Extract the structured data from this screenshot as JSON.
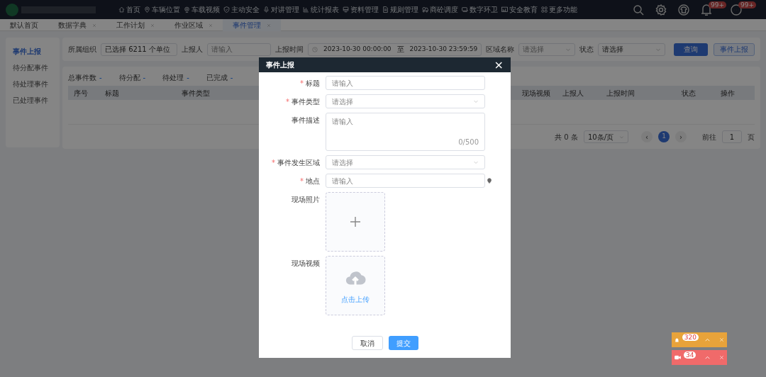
{
  "topnav": {
    "items": [
      {
        "label": "首页",
        "kind": "home"
      },
      {
        "label": "车辆位置",
        "kind": "pin"
      },
      {
        "label": "车载视频",
        "kind": "camera"
      },
      {
        "label": "主动安全",
        "kind": "shield"
      },
      {
        "label": "对讲管理",
        "kind": "mic"
      },
      {
        "label": "统计报表",
        "kind": "chart"
      },
      {
        "label": "资料管理",
        "kind": "monitor"
      },
      {
        "label": "规则管理",
        "kind": "doc"
      },
      {
        "label": "商砼调度",
        "kind": "truck"
      },
      {
        "label": "数字环卫",
        "kind": "screen"
      },
      {
        "label": "安全教育",
        "kind": "board"
      },
      {
        "label": "更多功能",
        "kind": "grid"
      }
    ],
    "tools": [
      {
        "kind": "search"
      },
      {
        "kind": "settings"
      },
      {
        "kind": "shirt"
      },
      {
        "kind": "bell",
        "badge": "99+"
      },
      {
        "kind": "more",
        "badge": "99+"
      }
    ]
  },
  "tabs": [
    {
      "label": "默认首页",
      "selected": false,
      "closable": false
    },
    {
      "label": "数据字典",
      "selected": false,
      "closable": true
    },
    {
      "label": "工作计划",
      "selected": false,
      "closable": true
    },
    {
      "label": "作业区域",
      "selected": false,
      "closable": true
    },
    {
      "label": "事件管理",
      "selected": true,
      "closable": true
    }
  ],
  "sidebar": {
    "items": [
      {
        "label": "事件上报",
        "selected": true
      },
      {
        "label": "待分配事件",
        "selected": false
      },
      {
        "label": "待处理事件",
        "selected": false
      },
      {
        "label": "已处理事件",
        "selected": false
      }
    ]
  },
  "filters": [
    {
      "label": "所属组织",
      "kind": "text",
      "value": "已选择 6211 个单位"
    },
    {
      "label": "上报人",
      "kind": "text",
      "placeholder": "请输入"
    },
    {
      "label": "上报时间",
      "kind": "daterange",
      "start": "2023-10-30 00:00:00",
      "separator": "至",
      "end": "2023-10-30 23:59:59"
    },
    {
      "label": "区域名称",
      "kind": "select",
      "placeholder": "请选择"
    },
    {
      "label": "状态",
      "kind": "select",
      "value": "请选择"
    }
  ],
  "actions": [
    {
      "label": "查询",
      "kind": "primary"
    },
    {
      "label": "事件上报",
      "kind": "plain"
    }
  ],
  "stats": [
    {
      "label": "总事件数",
      "value": "-"
    },
    {
      "label": "待分配",
      "value": "-"
    },
    {
      "label": "待处理",
      "value": "-"
    },
    {
      "label": "已完成",
      "value": "-"
    }
  ],
  "table": {
    "columns": [
      "序号",
      "标题",
      "事件类型",
      "现场视频",
      "上报人",
      "上报时间",
      "状态",
      "操作"
    ]
  },
  "pagination": {
    "total": "共 0 条",
    "page_size": "10条/页",
    "prev": "‹",
    "pages": [
      {
        "label": "1",
        "selected": true
      }
    ],
    "next": "›",
    "goto": "前往",
    "goto_value": "1",
    "goto_suffix": "页"
  },
  "modal": {
    "title": "事件上报",
    "close": "×",
    "required_mark": "*",
    "fields": [
      {
        "label": "标题",
        "required": true,
        "kind": "input",
        "placeholder": "请输入"
      },
      {
        "label": "事件类型",
        "required": true,
        "kind": "select",
        "placeholder": "请选择"
      },
      {
        "label": "事件描述",
        "required": false,
        "kind": "textarea",
        "placeholder": "请输入",
        "counter": "0/500"
      },
      {
        "label": "事件发生区域",
        "required": true,
        "kind": "select",
        "placeholder": "请选择"
      },
      {
        "label": "地点",
        "required": true,
        "kind": "location",
        "placeholder": "请输入"
      },
      {
        "label": "现场照片",
        "required": false,
        "kind": "photo"
      },
      {
        "label": "现场视频",
        "required": false,
        "kind": "video",
        "hint": "点击上传"
      }
    ],
    "buttons": [
      {
        "label": "取消",
        "kind": "plain"
      },
      {
        "label": "提交",
        "kind": "primary"
      }
    ]
  },
  "floating_alerts": [
    {
      "kind": "alarm",
      "count": "320",
      "color": "#e8a33a"
    },
    {
      "kind": "video",
      "count": "34",
      "color": "#f06a6a"
    }
  ]
}
